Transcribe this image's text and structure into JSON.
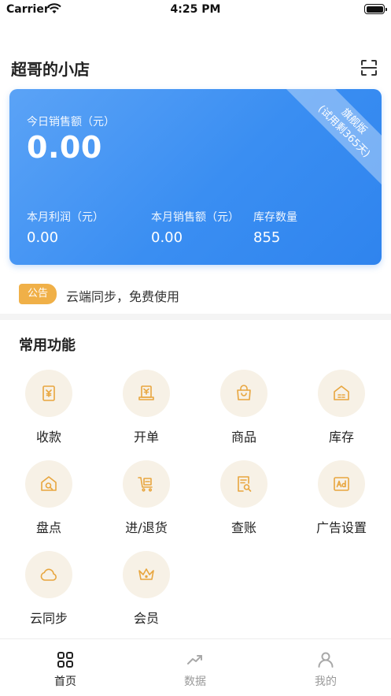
{
  "status_bar": {
    "carrier": "Carrier",
    "time": "4:25 PM"
  },
  "header": {
    "title": "超哥的小店",
    "scan_icon": "scan-icon"
  },
  "sales_card": {
    "ribbon_line1": "旗舰版",
    "ribbon_line2": "(试用剩365天)",
    "today_label": "今日销售额（元）",
    "today_value": "0.00",
    "stats": [
      {
        "label": "本月利润（元）",
        "value": "0.00"
      },
      {
        "label": "本月销售额（元）",
        "value": "0.00"
      },
      {
        "label": "库存数量",
        "value": "855"
      }
    ],
    "accent": "#3a8ef2"
  },
  "notice": {
    "badge": "公告",
    "text": "云端同步，免费使用",
    "badge_color": "#f0b048"
  },
  "section_title": "常用功能",
  "functions": [
    {
      "label": "收款",
      "icon": "cash-register-icon"
    },
    {
      "label": "开单",
      "icon": "receipt-printer-icon"
    },
    {
      "label": "商品",
      "icon": "shopping-bag-icon"
    },
    {
      "label": "库存",
      "icon": "warehouse-icon"
    },
    {
      "label": "盘点",
      "icon": "house-search-icon"
    },
    {
      "label": "进/退货",
      "icon": "cart-icon"
    },
    {
      "label": "查账",
      "icon": "ledger-search-icon"
    },
    {
      "label": "广告设置",
      "icon": "ad-icon"
    },
    {
      "label": "云同步",
      "icon": "cloud-icon"
    },
    {
      "label": "会员",
      "icon": "crown-icon"
    }
  ],
  "icon_color": "#e8a63f",
  "tabbar": [
    {
      "label": "首页",
      "icon": "home-grid-icon",
      "active": true
    },
    {
      "label": "数据",
      "icon": "trend-icon",
      "active": false
    },
    {
      "label": "我的",
      "icon": "person-icon",
      "active": false
    }
  ]
}
